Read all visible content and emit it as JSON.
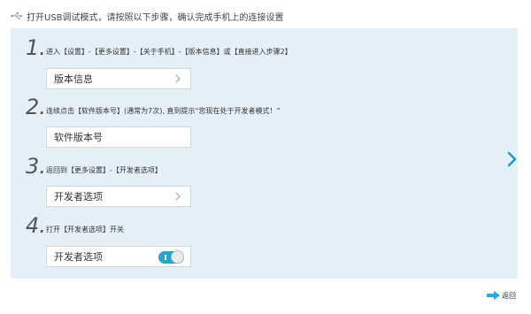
{
  "header": {
    "icon": "usb-icon",
    "text": "打开USB调试模式，请按照以下步骤，确认完成手机上的连接设置"
  },
  "steps": [
    {
      "number": "1.",
      "text": "进入【设置】-【更多设置】-【关于手机】-【版本信息】或【直接进入步骤2】",
      "field": {
        "label": "版本信息",
        "control": "chevron-right-icon"
      }
    },
    {
      "number": "2.",
      "text": "连续点击【软件版本号】(通常为7次), 直到提示“您现在处于开发者模式！”",
      "field": {
        "label": "软件版本号",
        "control": ""
      }
    },
    {
      "number": "3.",
      "text": "返回到【更多设置】-【开发者选项】",
      "field": {
        "label": "开发者选项",
        "control": "chevron-right-icon"
      }
    },
    {
      "number": "4.",
      "text": "打开【开发者选项】开关",
      "field": {
        "label": "开发者选项",
        "control": "toggle-switch",
        "toggle_on": true
      }
    }
  ],
  "next_arrow": {
    "icon": "chevron-right-icon",
    "color": "#1a9ad6"
  },
  "back": {
    "icon": "arrow-right-icon",
    "label": "返回",
    "color": "#2aa7e0"
  },
  "colors": {
    "panel_bg": "#e4f0f5",
    "accent": "#1fa6d3"
  }
}
